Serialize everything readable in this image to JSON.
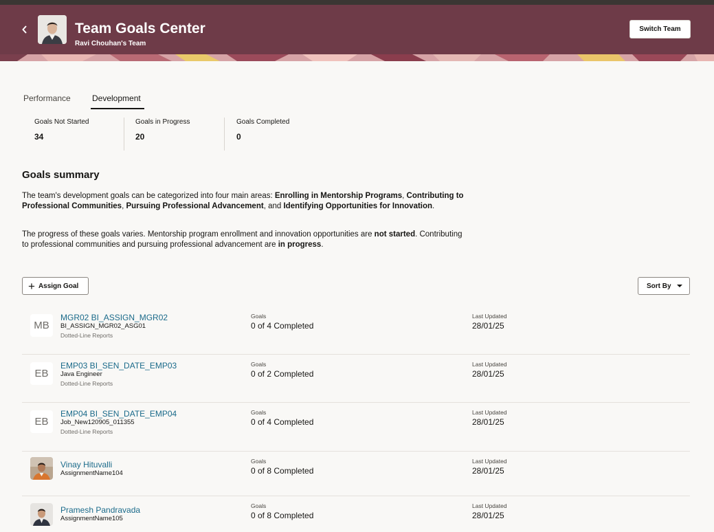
{
  "header": {
    "title": "Team Goals Center",
    "subtitle": "Ravi Chouhan's Team",
    "switch_label": "Switch Team",
    "back_icon": "chevron-left-icon",
    "background": "#6e3b48"
  },
  "tabs": [
    {
      "label": "Performance",
      "selected": false
    },
    {
      "label": "Development",
      "selected": true
    }
  ],
  "metrics": [
    {
      "label": "Goals Not Started",
      "value": "34"
    },
    {
      "label": "Goals in Progress",
      "value": "20"
    },
    {
      "label": "Goals Completed",
      "value": "0"
    }
  ],
  "summary": {
    "title": "Goals summary",
    "p1": {
      "t1": "The team's development goals can be categorized into four main areas: ",
      "b1": "Enrolling in Mentorship Programs",
      "t2": ", ",
      "b2": "Contributing to Professional Communities",
      "t3": ", ",
      "b3": "Pursuing Professional Advancement",
      "t4": ", and ",
      "b4": "Identifying Opportunities for Innovation",
      "t5": "."
    },
    "p2": {
      "t1": "The progress of these goals varies. Mentorship program enrollment and innovation opportunities are ",
      "b1": "not started",
      "t2": ". Contributing to professional communities and pursuing professional advancement are ",
      "b2": "in progress",
      "t3": "."
    }
  },
  "toolbar": {
    "assign_label": "Assign Goal",
    "sort_label": "Sort By"
  },
  "rows": [
    {
      "initials": "MB",
      "name": "MGR02 BI_ASSIGN_MGR02",
      "sub1": "BI_ASSIGN_MGR02_ASG01",
      "sub2": "Dotted-Line Reports",
      "goals_label": "Goals",
      "goals_value": "0 of 4 Completed",
      "updated_label": "Last Updated",
      "updated_value": "28/01/25"
    },
    {
      "initials": "EB",
      "name": "EMP03 BI_SEN_DATE_EMP03",
      "sub1": "Java Engineer",
      "sub2": "Dotted-Line Reports",
      "goals_label": "Goals",
      "goals_value": "0 of 2 Completed",
      "updated_label": "Last Updated",
      "updated_value": "28/01/25"
    },
    {
      "initials": "EB",
      "name": "EMP04 BI_SEN_DATE_EMP04",
      "sub1": "Job_New120905_011355",
      "sub2": "Dotted-Line Reports",
      "goals_label": "Goals",
      "goals_value": "0 of 4 Completed",
      "updated_label": "Last Updated",
      "updated_value": "28/01/25"
    },
    {
      "initials": "",
      "name": "Vinay Hituvalli",
      "sub1": "AssignmentName104",
      "sub2": "",
      "goals_label": "Goals",
      "goals_value": "0 of 8 Completed",
      "updated_label": "Last Updated",
      "updated_value": "28/01/25"
    },
    {
      "initials": "",
      "name": "Pramesh Pandravada",
      "sub1": "AssignmentName105",
      "sub2": "",
      "goals_label": "Goals",
      "goals_value": "0 of 8 Completed",
      "updated_label": "Last Updated",
      "updated_value": "28/01/25"
    }
  ]
}
